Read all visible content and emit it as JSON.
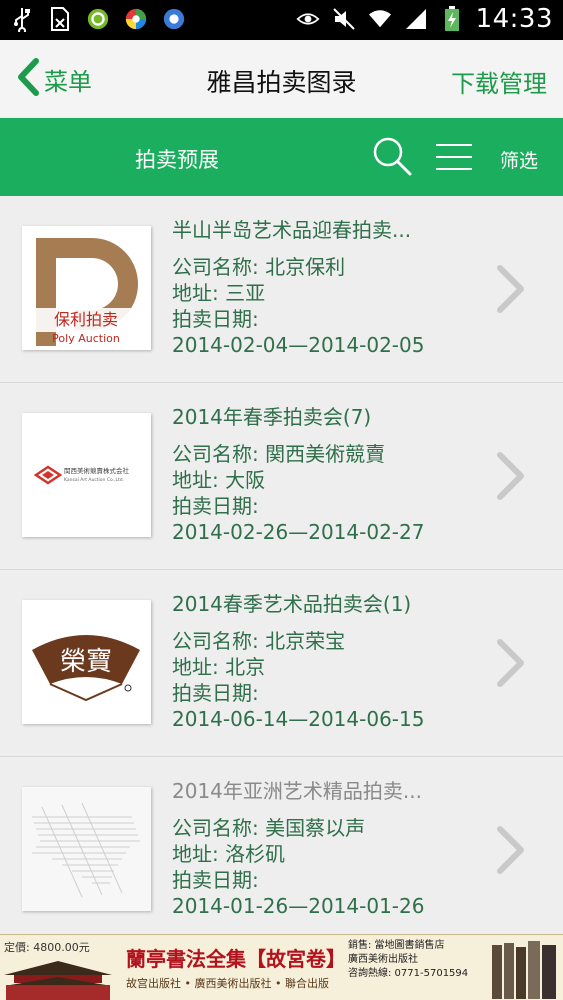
{
  "status_bar": {
    "time": "14:33"
  },
  "header": {
    "back_label": "菜单",
    "title": "雅昌拍卖图录",
    "download_label": "下载管理"
  },
  "tabs": {
    "active_label": "拍卖预展",
    "filter_label": "筛选"
  },
  "labels": {
    "company": "公司名称: ",
    "address": "地址: ",
    "date": "拍卖日期:"
  },
  "items": [
    {
      "title": "半山半岛艺术品迎春拍卖...",
      "company": "北京保利",
      "address": "三亚",
      "date_range": "2014-02-04—2014-02-05",
      "logo_text_cn": "保利拍卖",
      "logo_text_en": "Poly Auction"
    },
    {
      "title": "2014年春季拍卖会(7)",
      "company": "関西美術競賣",
      "address": "大阪",
      "date_range": "2014-02-26—2014-02-27",
      "logo_text_cn": "関西美術競賣株式会社",
      "logo_text_en": "Kansai Art Auction Co.,Ltd."
    },
    {
      "title": "2014春季艺术品拍卖会(1)",
      "company": "北京荣宝",
      "address": "北京",
      "date_range": "2014-06-14—2014-06-15",
      "logo_text_cn": "榮寶"
    },
    {
      "title": "2014年亚洲艺术精品拍卖...",
      "company": "美国蔡以声",
      "address": "洛杉矶",
      "date_range": "2014-01-26—2014-01-26"
    }
  ],
  "banner": {
    "price": "定價: 4800.00元",
    "title": "蘭亭書法全集【故宮卷】",
    "publishers": "故宫出版社 • 廣西美術出版社 • 聯合出版",
    "sales_line1": "銷售: 當地圖書銷售店",
    "sales_line2": "廣西美術出版社",
    "hotline": "咨詢熱線: 0771-5701594"
  },
  "colors": {
    "accent": "#1aae5e",
    "text_green": "#2f6f4a",
    "link_green": "#1d9b4a"
  }
}
